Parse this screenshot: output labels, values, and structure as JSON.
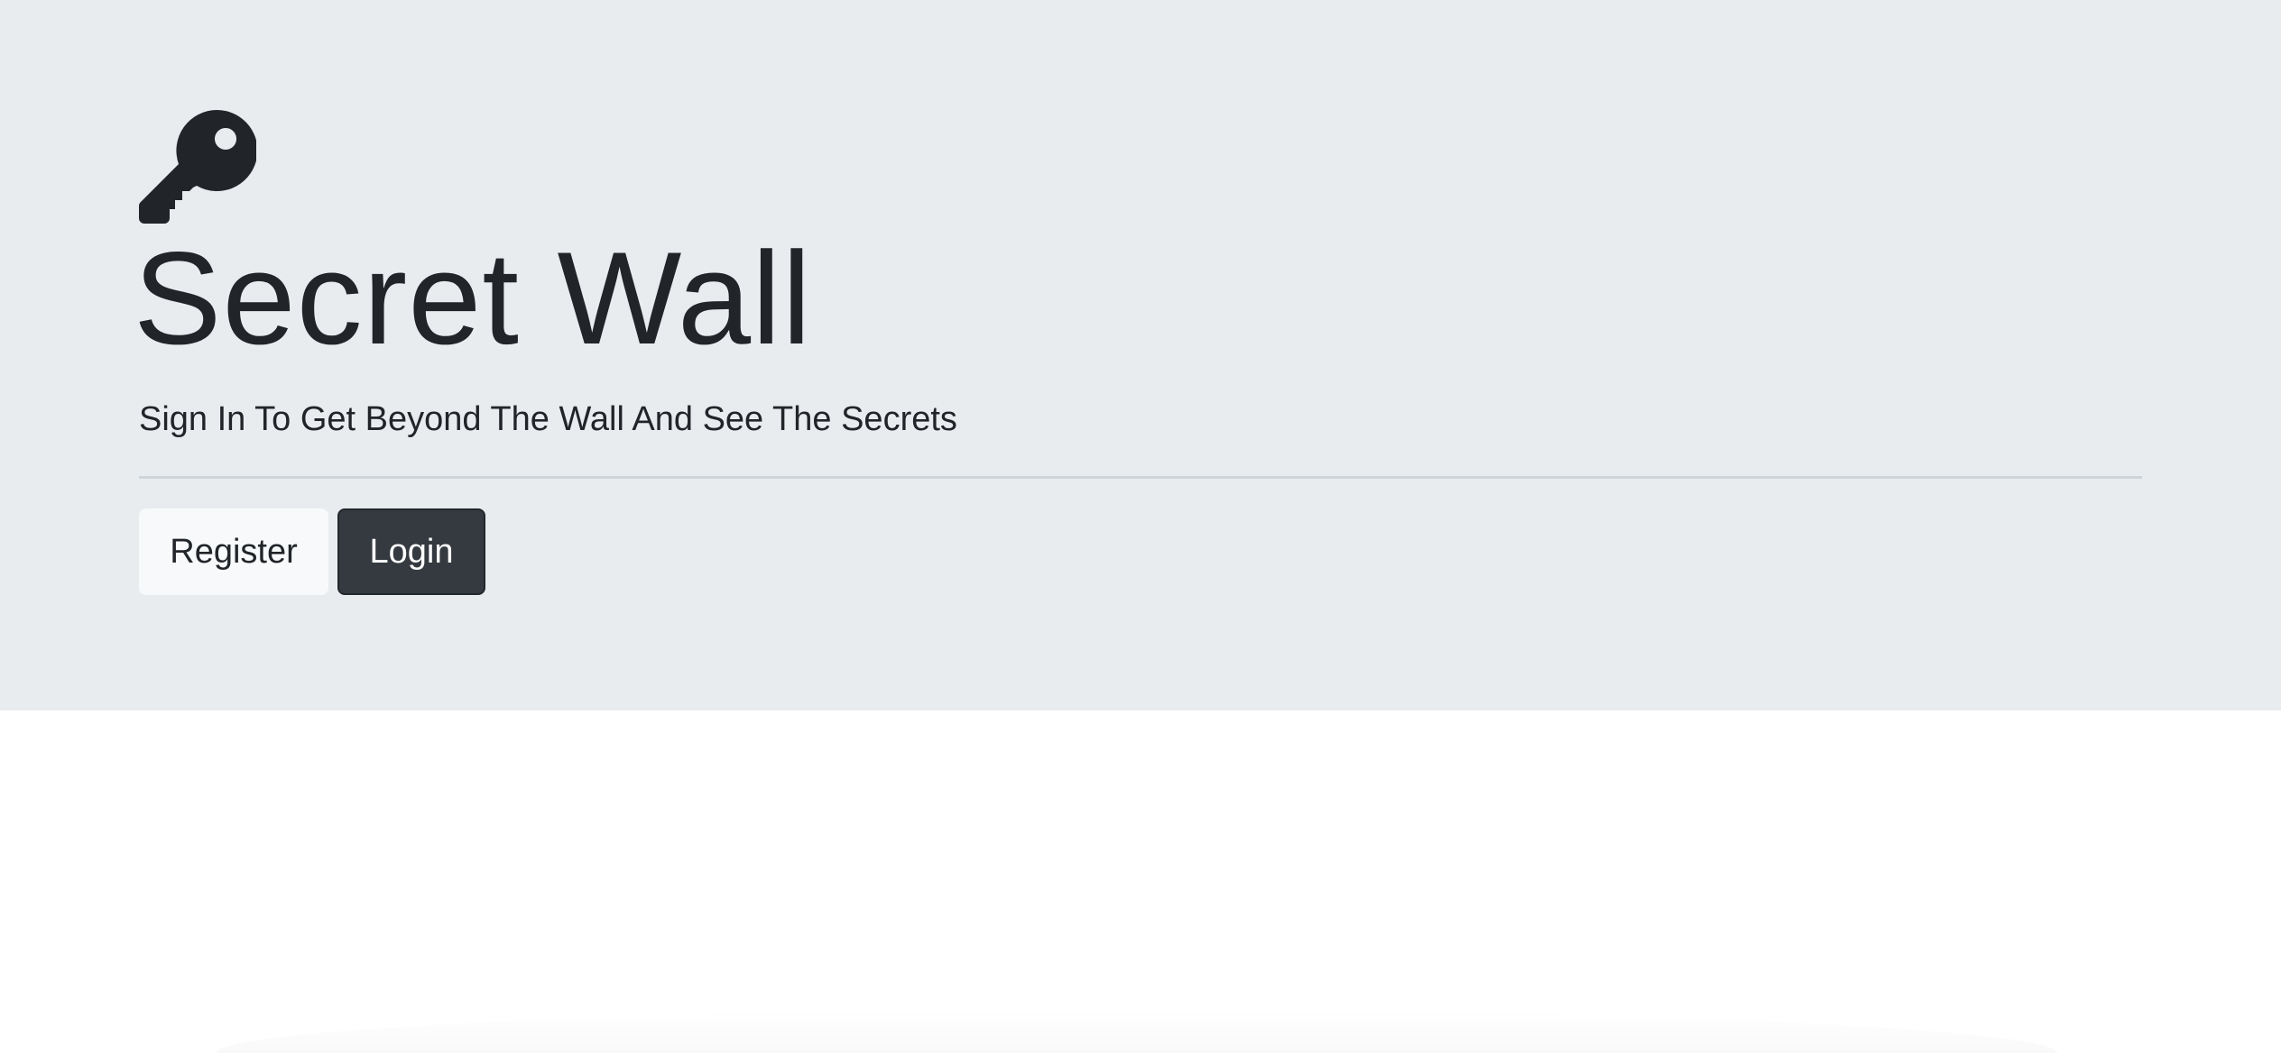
{
  "jumbotron": {
    "icon": "key-icon",
    "title": "Secret Wall",
    "lead": "Sign In To Get Beyond The Wall And See The Secrets"
  },
  "actions": {
    "register_label": "Register",
    "login_label": "Login"
  },
  "colors": {
    "jumbotron_bg": "#e9ecef",
    "text": "#212529",
    "btn_light_bg": "#f8f9fa",
    "btn_dark_bg": "#343a40",
    "divider": "#ced4da"
  }
}
